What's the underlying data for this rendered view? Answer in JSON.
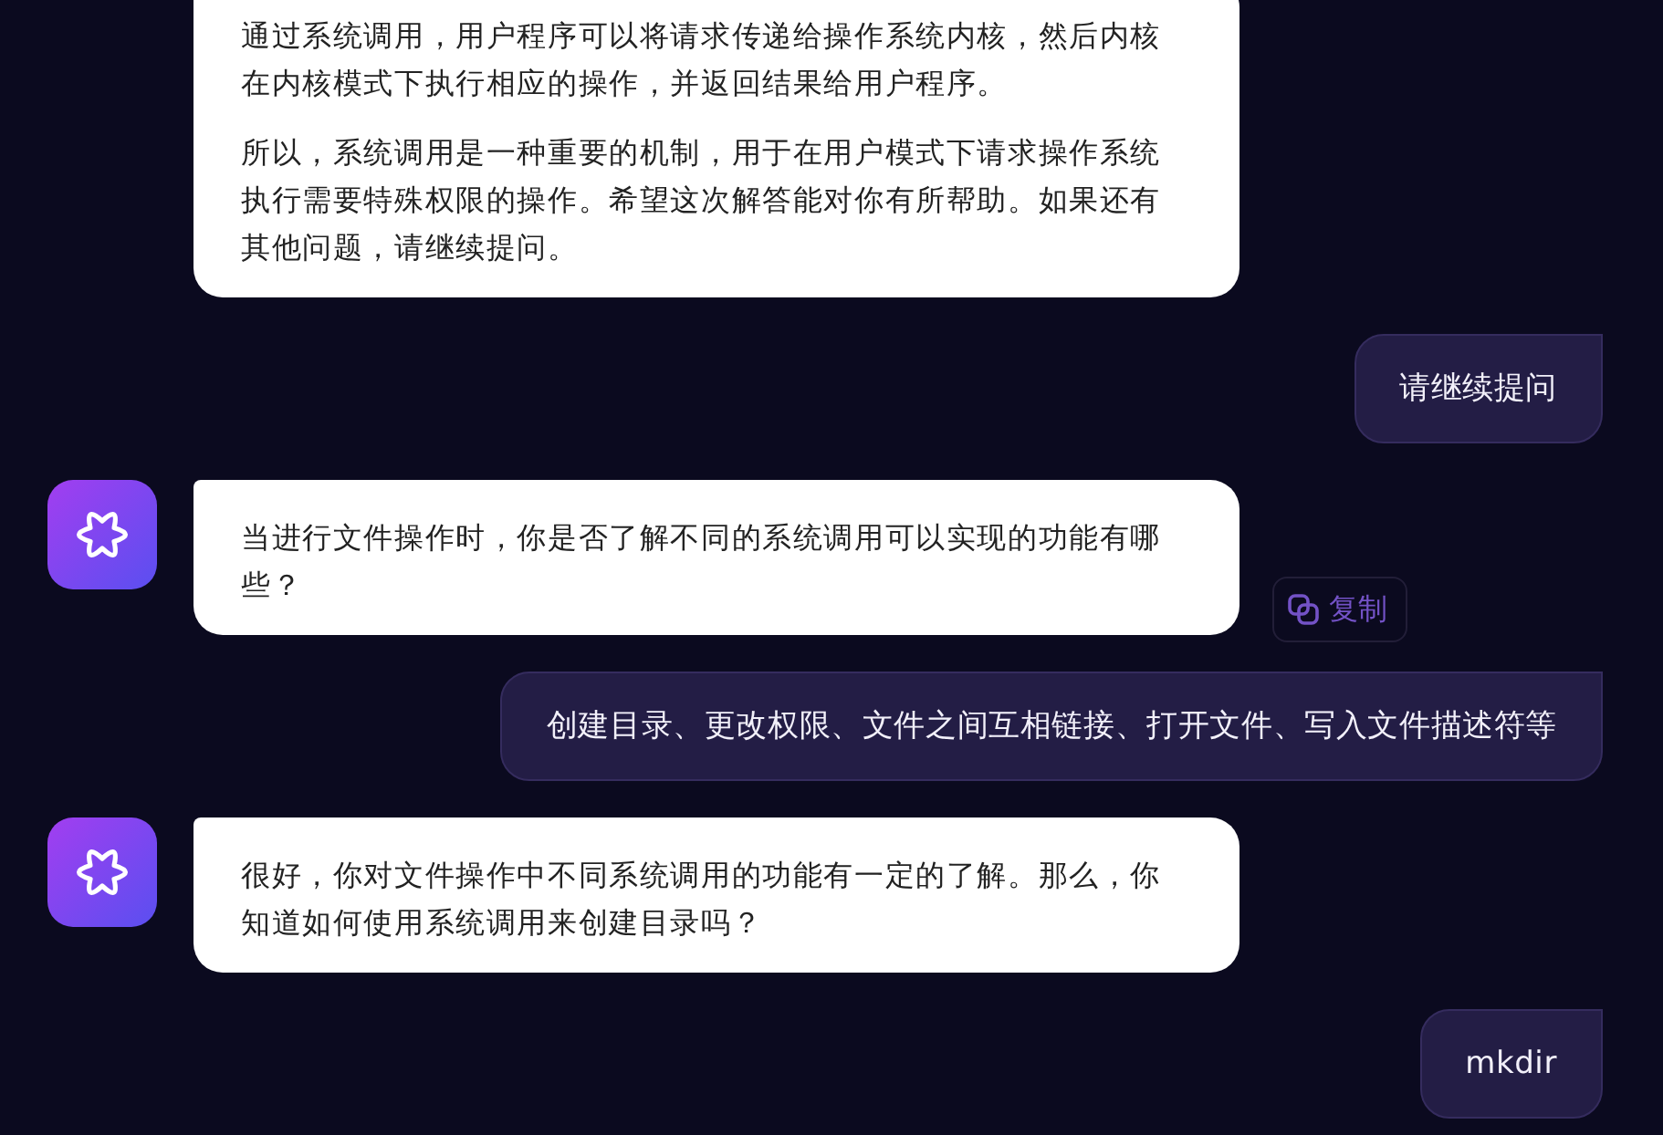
{
  "messages": [
    {
      "kind": "bot",
      "avatar": false,
      "paragraphs": [
        "通过系统调用，用户程序可以将请求传递给操作系统内核，然后内核在内核模式下执行相应的操作，并返回结果给用户程序。",
        "所以，系统调用是一种重要的机制，用于在用户模式下请求操作系统执行需要特殊权限的操作。希望这次解答能对你有所帮助。如果还有其他问题，请继续提问。"
      ]
    },
    {
      "kind": "user",
      "text": "请继续提问"
    },
    {
      "kind": "bot",
      "avatar": true,
      "paragraphs": [
        "当进行文件操作时，你是否了解不同的系统调用可以实现的功能有哪些？"
      ],
      "copy_label": "复制"
    },
    {
      "kind": "user",
      "text": "创建目录、更改权限、文件之间互相链接、打开文件、写入文件描述符等"
    },
    {
      "kind": "bot",
      "avatar": true,
      "paragraphs": [
        "很好，你对文件操作中不同系统调用的功能有一定的了解。那么，你知道如何使用系统调用来创建目录吗？"
      ]
    },
    {
      "kind": "user",
      "text": "mkdir"
    }
  ]
}
